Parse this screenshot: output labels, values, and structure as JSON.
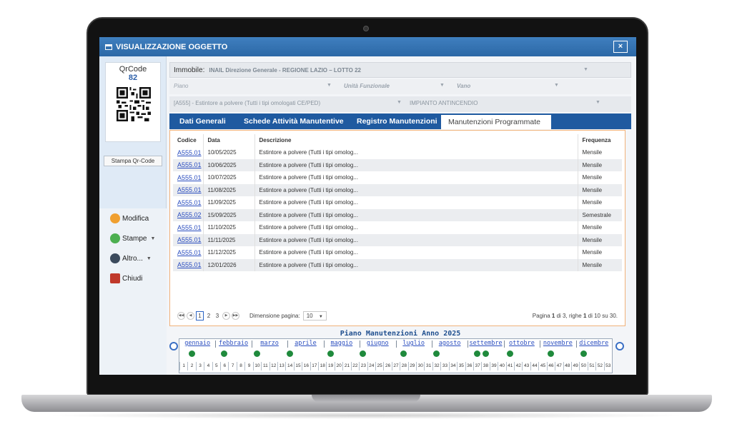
{
  "window": {
    "title": "VISUALIZZAZIONE OGGETTO",
    "close_label": "×"
  },
  "left_panel": {
    "qr_title": "QrCode",
    "qr_number": "82",
    "qr_button": "Stampa Qr-Code",
    "actions": [
      {
        "label": "Modifica",
        "icon": "edit-icon",
        "color": "#f0a030",
        "dropdown": false
      },
      {
        "label": "Stampe",
        "icon": "print-icon",
        "color": "#4caf50",
        "dropdown": true
      },
      {
        "label": "Altro...",
        "icon": "more-icon",
        "color": "#3a4a5c",
        "dropdown": true
      },
      {
        "label": "Chiudi",
        "icon": "close-doc-icon",
        "color": "#c0392b",
        "dropdown": false
      }
    ]
  },
  "filters": {
    "immobile_label": "Immobile:",
    "immobile_value": "INAIL Direzione Generale - REGIONE LAZIO – LOTTO 22",
    "piano_placeholder": "Piano",
    "unita_placeholder": "Unità Funzionale",
    "vano_placeholder": "Vano",
    "oggetto_value": "[A555] - Estintore a polvere (Tutti i tipi omologati CE/PED)",
    "impianto_value": "IMPIANTO ANTINCENDIO"
  },
  "tabs": [
    {
      "label": "Dati Generali",
      "active": false
    },
    {
      "label": "Schede Attività Manutentive",
      "active": false
    },
    {
      "label": "Registro Manutenzioni",
      "active": false
    },
    {
      "label": "Manutenzioni Programmate",
      "active": true
    }
  ],
  "grid": {
    "headers": [
      "Codice",
      "Data",
      "Descrizione",
      "Frequenza"
    ],
    "rows": [
      {
        "codice": "A555.01",
        "data": "10/05/2025",
        "descrizione": "Estintore a polvere (Tutti i tipi omolog...",
        "frequenza": "Mensile"
      },
      {
        "codice": "A555.01",
        "data": "10/06/2025",
        "descrizione": "Estintore a polvere (Tutti i tipi omolog...",
        "frequenza": "Mensile"
      },
      {
        "codice": "A555.01",
        "data": "10/07/2025",
        "descrizione": "Estintore a polvere (Tutti i tipi omolog...",
        "frequenza": "Mensile"
      },
      {
        "codice": "A555.01",
        "data": "11/08/2025",
        "descrizione": "Estintore a polvere (Tutti i tipi omolog...",
        "frequenza": "Mensile"
      },
      {
        "codice": "A555.01",
        "data": "11/09/2025",
        "descrizione": "Estintore a polvere (Tutti i tipi omolog...",
        "frequenza": "Mensile"
      },
      {
        "codice": "A555.02",
        "data": "15/09/2025",
        "descrizione": "Estintore a polvere (Tutti i tipi omolog...",
        "frequenza": "Semestrale"
      },
      {
        "codice": "A555.01",
        "data": "11/10/2025",
        "descrizione": "Estintore a polvere (Tutti i tipi omolog...",
        "frequenza": "Mensile"
      },
      {
        "codice": "A555.01",
        "data": "11/11/2025",
        "descrizione": "Estintore a polvere (Tutti i tipi omolog...",
        "frequenza": "Mensile"
      },
      {
        "codice": "A555.01",
        "data": "11/12/2025",
        "descrizione": "Estintore a polvere (Tutti i tipi omolog...",
        "frequenza": "Mensile"
      },
      {
        "codice": "A555.01",
        "data": "12/01/2026",
        "descrizione": "Estintore a polvere (Tutti i tipi omolog...",
        "frequenza": "Mensile"
      }
    ]
  },
  "pager": {
    "pages": [
      "1",
      "2",
      "3"
    ],
    "current_page": "1",
    "size_label": "Dimensione pagina:",
    "size_value": "10",
    "info_prefix": "Pagina ",
    "info_page": "1",
    "info_mid": " di 3, righe ",
    "info_rows": "1",
    "info_suffix": " di 10 su 30."
  },
  "plan": {
    "title": "Piano Manutenzioni Anno 2025",
    "months": [
      "gennaio",
      "febbraio",
      "marzo",
      "aprile",
      "maggio",
      "giugno",
      "luglio",
      "agosto",
      "settembre",
      "ottobre",
      "novembre",
      "dicembre"
    ],
    "weeks_count": 53,
    "highlighted_weeks": [
      2,
      6,
      10,
      14,
      19,
      23,
      28,
      32,
      37,
      38,
      41,
      46,
      50
    ],
    "dot_color": "#1f8a3c"
  }
}
